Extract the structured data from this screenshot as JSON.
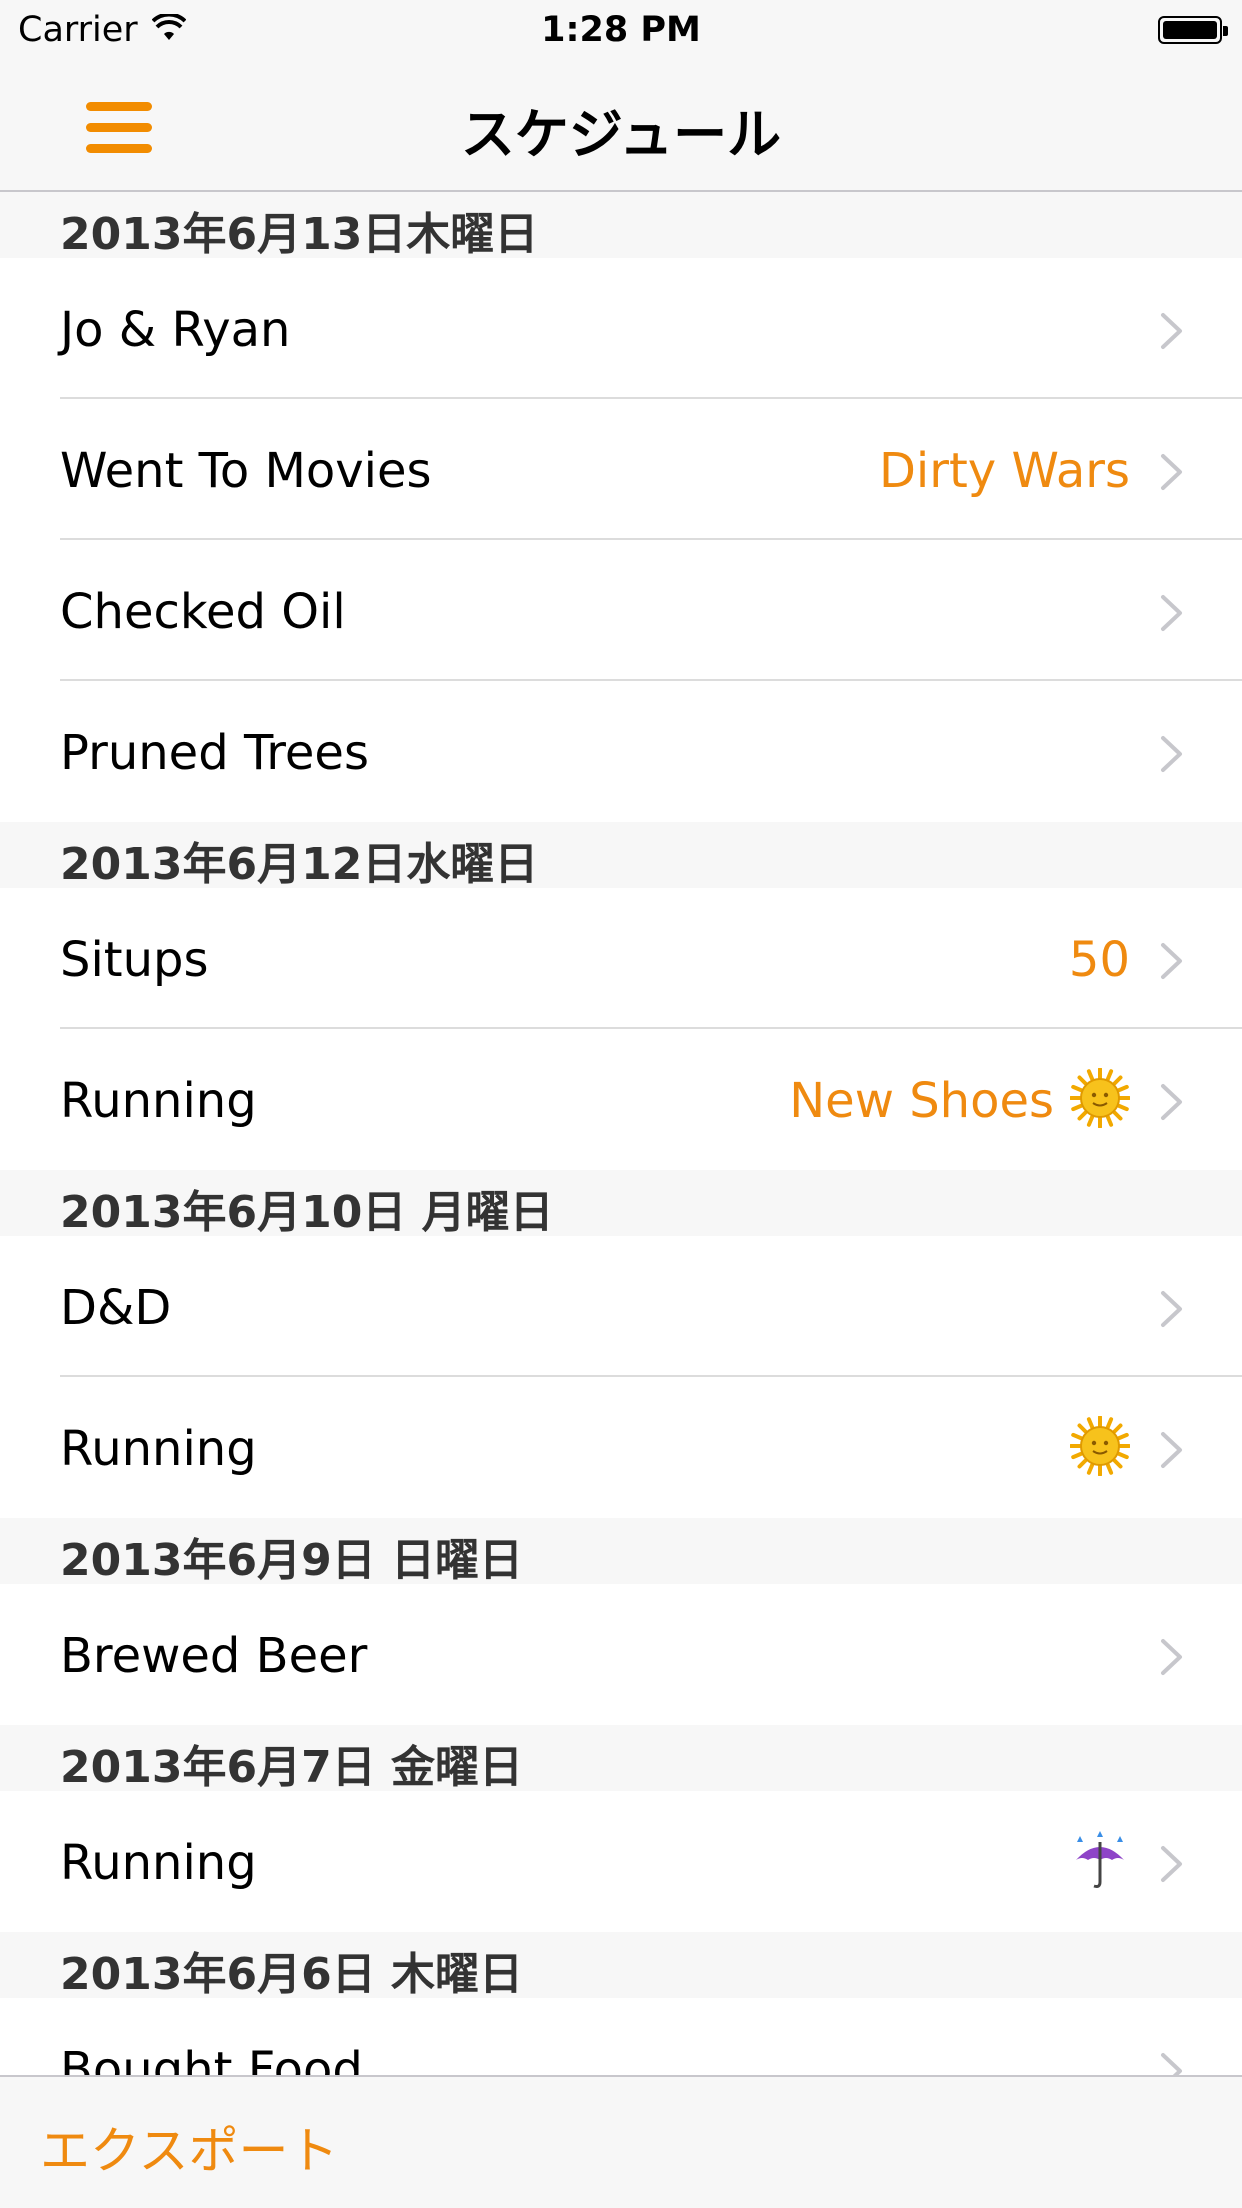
{
  "status_bar": {
    "carrier": "Carrier",
    "time": "1:28 PM"
  },
  "nav": {
    "title": "スケジュール"
  },
  "sections": [
    {
      "header": "2013年6月13日木曜日",
      "rows": [
        {
          "title": "Jo & Ryan",
          "detail": ""
        },
        {
          "title": "Went To Movies",
          "detail": "Dirty Wars"
        },
        {
          "title": "Checked Oil",
          "detail": ""
        },
        {
          "title": "Pruned Trees",
          "detail": ""
        }
      ]
    },
    {
      "header": "2013年6月12日水曜日",
      "rows": [
        {
          "title": "Situps",
          "detail": "50"
        },
        {
          "title": "Running",
          "detail": "New Shoes",
          "emoji": "sun-face-icon"
        }
      ]
    },
    {
      "header": "2013年6月10日 月曜日",
      "rows": [
        {
          "title": "D&D",
          "detail": ""
        },
        {
          "title": "Running",
          "detail": "",
          "emoji": "sun-face-icon"
        }
      ]
    },
    {
      "header": "2013年6月9日 日曜日",
      "rows": [
        {
          "title": "Brewed Beer",
          "detail": ""
        }
      ]
    },
    {
      "header": "2013年6月7日 金曜日",
      "rows": [
        {
          "title": "Running",
          "detail": "",
          "emoji": "umbrella-rain-icon"
        }
      ]
    },
    {
      "header": "2013年6月6日 木曜日",
      "rows": [
        {
          "title": "Bought Food",
          "detail": ""
        }
      ]
    }
  ],
  "toolbar": {
    "export_label": "エクスポート"
  },
  "colors": {
    "accent": "#ef8a10",
    "menu": "#f28c00",
    "header_bg": "#f7f7f7"
  }
}
